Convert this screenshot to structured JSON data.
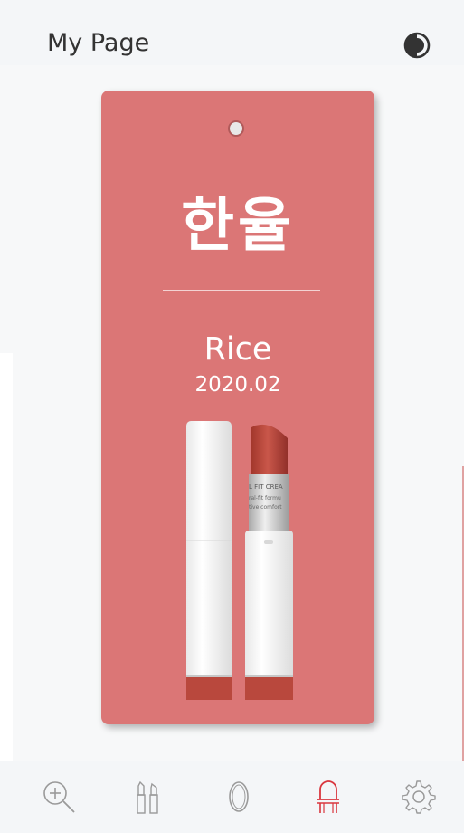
{
  "header": {
    "title": "My Page",
    "theme_icon": "contrast-icon"
  },
  "card": {
    "brand": "한율",
    "shade": "Rice",
    "date": "2020.02",
    "colors": {
      "card_bg": "#db7676",
      "lip_color": "#b9483d"
    }
  },
  "nav": {
    "active_index": 3,
    "accent_color": "#d9363e",
    "items": [
      {
        "icon": "search-add-icon"
      },
      {
        "icon": "lipstick-icon"
      },
      {
        "icon": "mirror-icon"
      },
      {
        "icon": "vanity-chair-icon"
      },
      {
        "icon": "gear-icon"
      }
    ]
  }
}
